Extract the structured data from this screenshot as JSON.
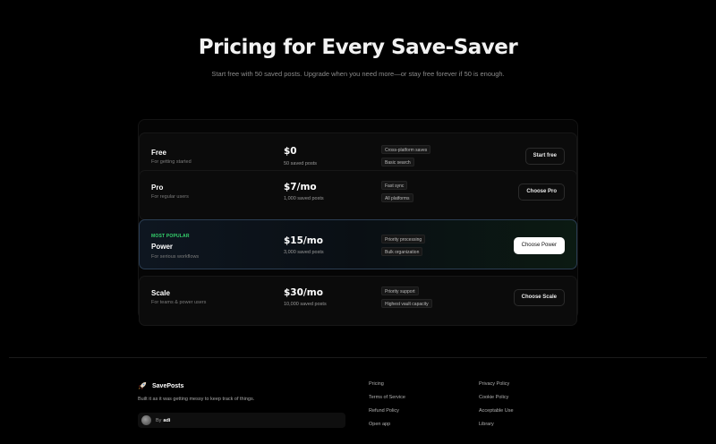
{
  "hero": {
    "title": "Pricing for Every Save-Saver",
    "subtitle": "Start free with 50 saved posts. Upgrade when you need more—or stay free forever if 50 is enough."
  },
  "plans": [
    {
      "name": "Free",
      "desc": "For getting started",
      "price": "$0",
      "posts": "50 saved posts",
      "features": [
        "Cross-platform saves",
        "Basic search"
      ],
      "button": "Start free"
    },
    {
      "name": "Pro",
      "desc": "For regular users",
      "price": "$7/mo",
      "posts": "1,000 saved posts",
      "features": [
        "Fast sync",
        "All platforms"
      ],
      "button": "Choose Pro"
    },
    {
      "tag": "MOST POPULAR",
      "name": "Power",
      "desc": "For serious workflows",
      "price": "$15/mo",
      "posts": "3,000 saved posts",
      "features": [
        "Priority processing",
        "Bulk organization"
      ],
      "button": "Choose Power"
    },
    {
      "name": "Scale",
      "desc": "For teams & power users",
      "price": "$30/mo",
      "posts": "10,000 saved posts",
      "features": [
        "Priority support",
        "Highest vault capacity"
      ],
      "button": "Choose Scale"
    }
  ],
  "footer": {
    "brand": "SavePosts",
    "brand_icon": "rocket-icon",
    "tagline": "Built it as it was getting messy to keep track of things.",
    "author_by": "By",
    "author_name": "adi",
    "links_col1": [
      "Pricing",
      "Terms of Service",
      "Refund Policy",
      "Open app"
    ],
    "links_col2": [
      "Privacy Policy",
      "Cookie Policy",
      "Acceptable Use",
      "Library"
    ]
  },
  "colors": {
    "background": "#000000",
    "popular_accent": "#35d36d",
    "popular_border": "#2b3d52"
  }
}
